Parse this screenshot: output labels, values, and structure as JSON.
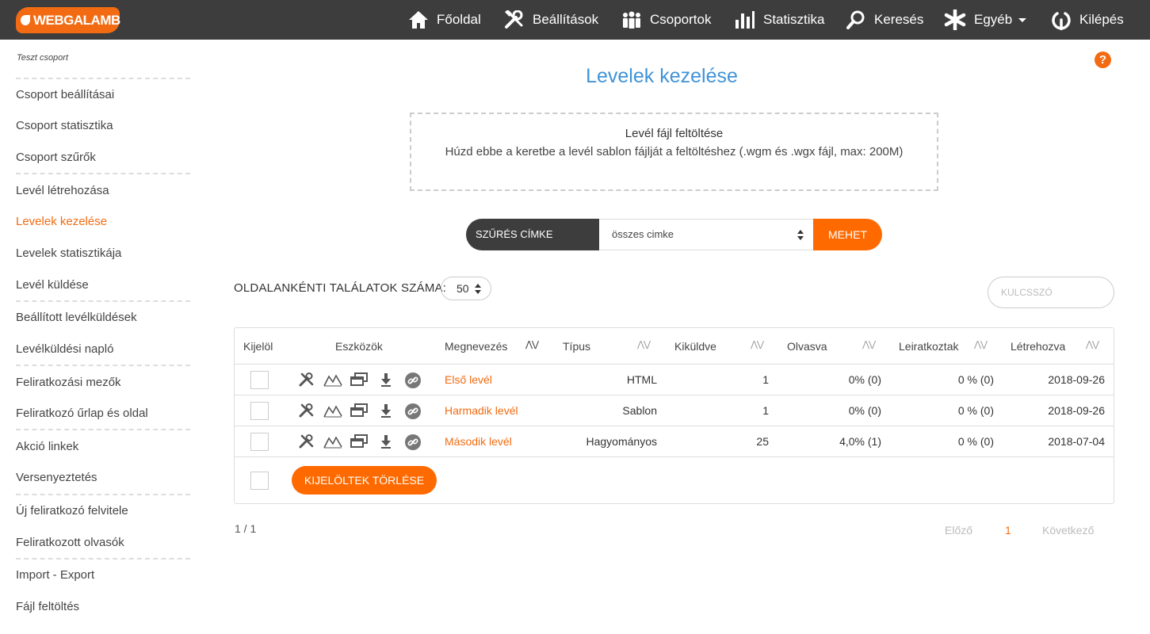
{
  "app": {
    "logo_text": "WEBGALAMB"
  },
  "nav": [
    {
      "label": "Főoldal",
      "icon": "home-icon"
    },
    {
      "label": "Beállítások",
      "icon": "tools-icon"
    },
    {
      "label": "Csoportok",
      "icon": "group-icon"
    },
    {
      "label": "Statisztika",
      "icon": "bar-chart-icon"
    },
    {
      "label": "Keresés",
      "icon": "search-icon"
    },
    {
      "label": "Egyéb",
      "icon": "asterisk-icon"
    },
    {
      "label": "Kilépés",
      "icon": "logout-icon"
    }
  ],
  "sidebar": {
    "group_title": "Teszt csoport",
    "items": [
      {
        "label": "Csoport beállításai"
      },
      {
        "label": "Csoport statisztika"
      },
      {
        "label": "Csoport szűrők"
      },
      {
        "label": "Levél létrehozása"
      },
      {
        "label": "Levelek kezelése",
        "active": true
      },
      {
        "label": "Levelek statisztikája"
      },
      {
        "label": "Levél küldése"
      },
      {
        "label": "Beállított levélküldések"
      },
      {
        "label": "Levélküldési napló"
      },
      {
        "label": "Feliratkozási mezők"
      },
      {
        "label": "Feliratkozó űrlap és oldal"
      },
      {
        "label": "Akció linkek"
      },
      {
        "label": "Versenyeztetés"
      },
      {
        "label": "Új feliratkozó felvitele"
      },
      {
        "label": "Feliratkozott olvasók"
      },
      {
        "label": "Import - Export"
      },
      {
        "label": "Fájl feltöltés"
      }
    ]
  },
  "main": {
    "title": "Levelek kezelése",
    "help_label": "?",
    "upload": {
      "title": "Levél fájl feltöltése",
      "description": "Húzd ebbe a keretbe a levél sablon fájlját a feltöltéshez  (.wgm és .wgx fájl, max: 200M)"
    },
    "filter": {
      "label": "SZŰRÉS CÍMKE SZERINT",
      "selected": "összes cimke",
      "button": "MEHET"
    },
    "per_page": {
      "label": "OLDALANKÉNTI TALÁLATOK SZÁMA:",
      "value": "50"
    },
    "search": {
      "placeholder": "KULCSSZÓ"
    }
  },
  "table": {
    "columns": {
      "select": "Kijelöl",
      "tools": "Eszközök",
      "name": "Megnevezés",
      "type": "Típus",
      "sent": "Kiküldve",
      "read": "Olvasva",
      "unsubscribed": "Leiratkoztak",
      "created": "Létrehozva"
    },
    "rows": [
      {
        "name": "Első levél",
        "type": "HTML",
        "sent": "1",
        "read": "0% (0)",
        "unsubscribed": "0 % (0)",
        "created": "2018-09-26"
      },
      {
        "name": "Harmadik levél",
        "type": "Sablon",
        "sent": "1",
        "read": "0% (0)",
        "unsubscribed": "0 % (0)",
        "created": "2018-09-26"
      },
      {
        "name": "Második levél",
        "type": "Hagyományos",
        "sent": "25",
        "read": "4,0% (1)",
        "unsubscribed": "0 % (0)",
        "created": "2018-07-04"
      }
    ],
    "delete_button": "KIJELÖLTEK TÖRLÉSE"
  },
  "pagination": {
    "info": "1 / 1",
    "prev": "Előző",
    "current": "1",
    "next": "Következő"
  },
  "colors": {
    "accent": "#f26b12",
    "topbar": "#3d3d3d",
    "title": "#3f93d8"
  }
}
